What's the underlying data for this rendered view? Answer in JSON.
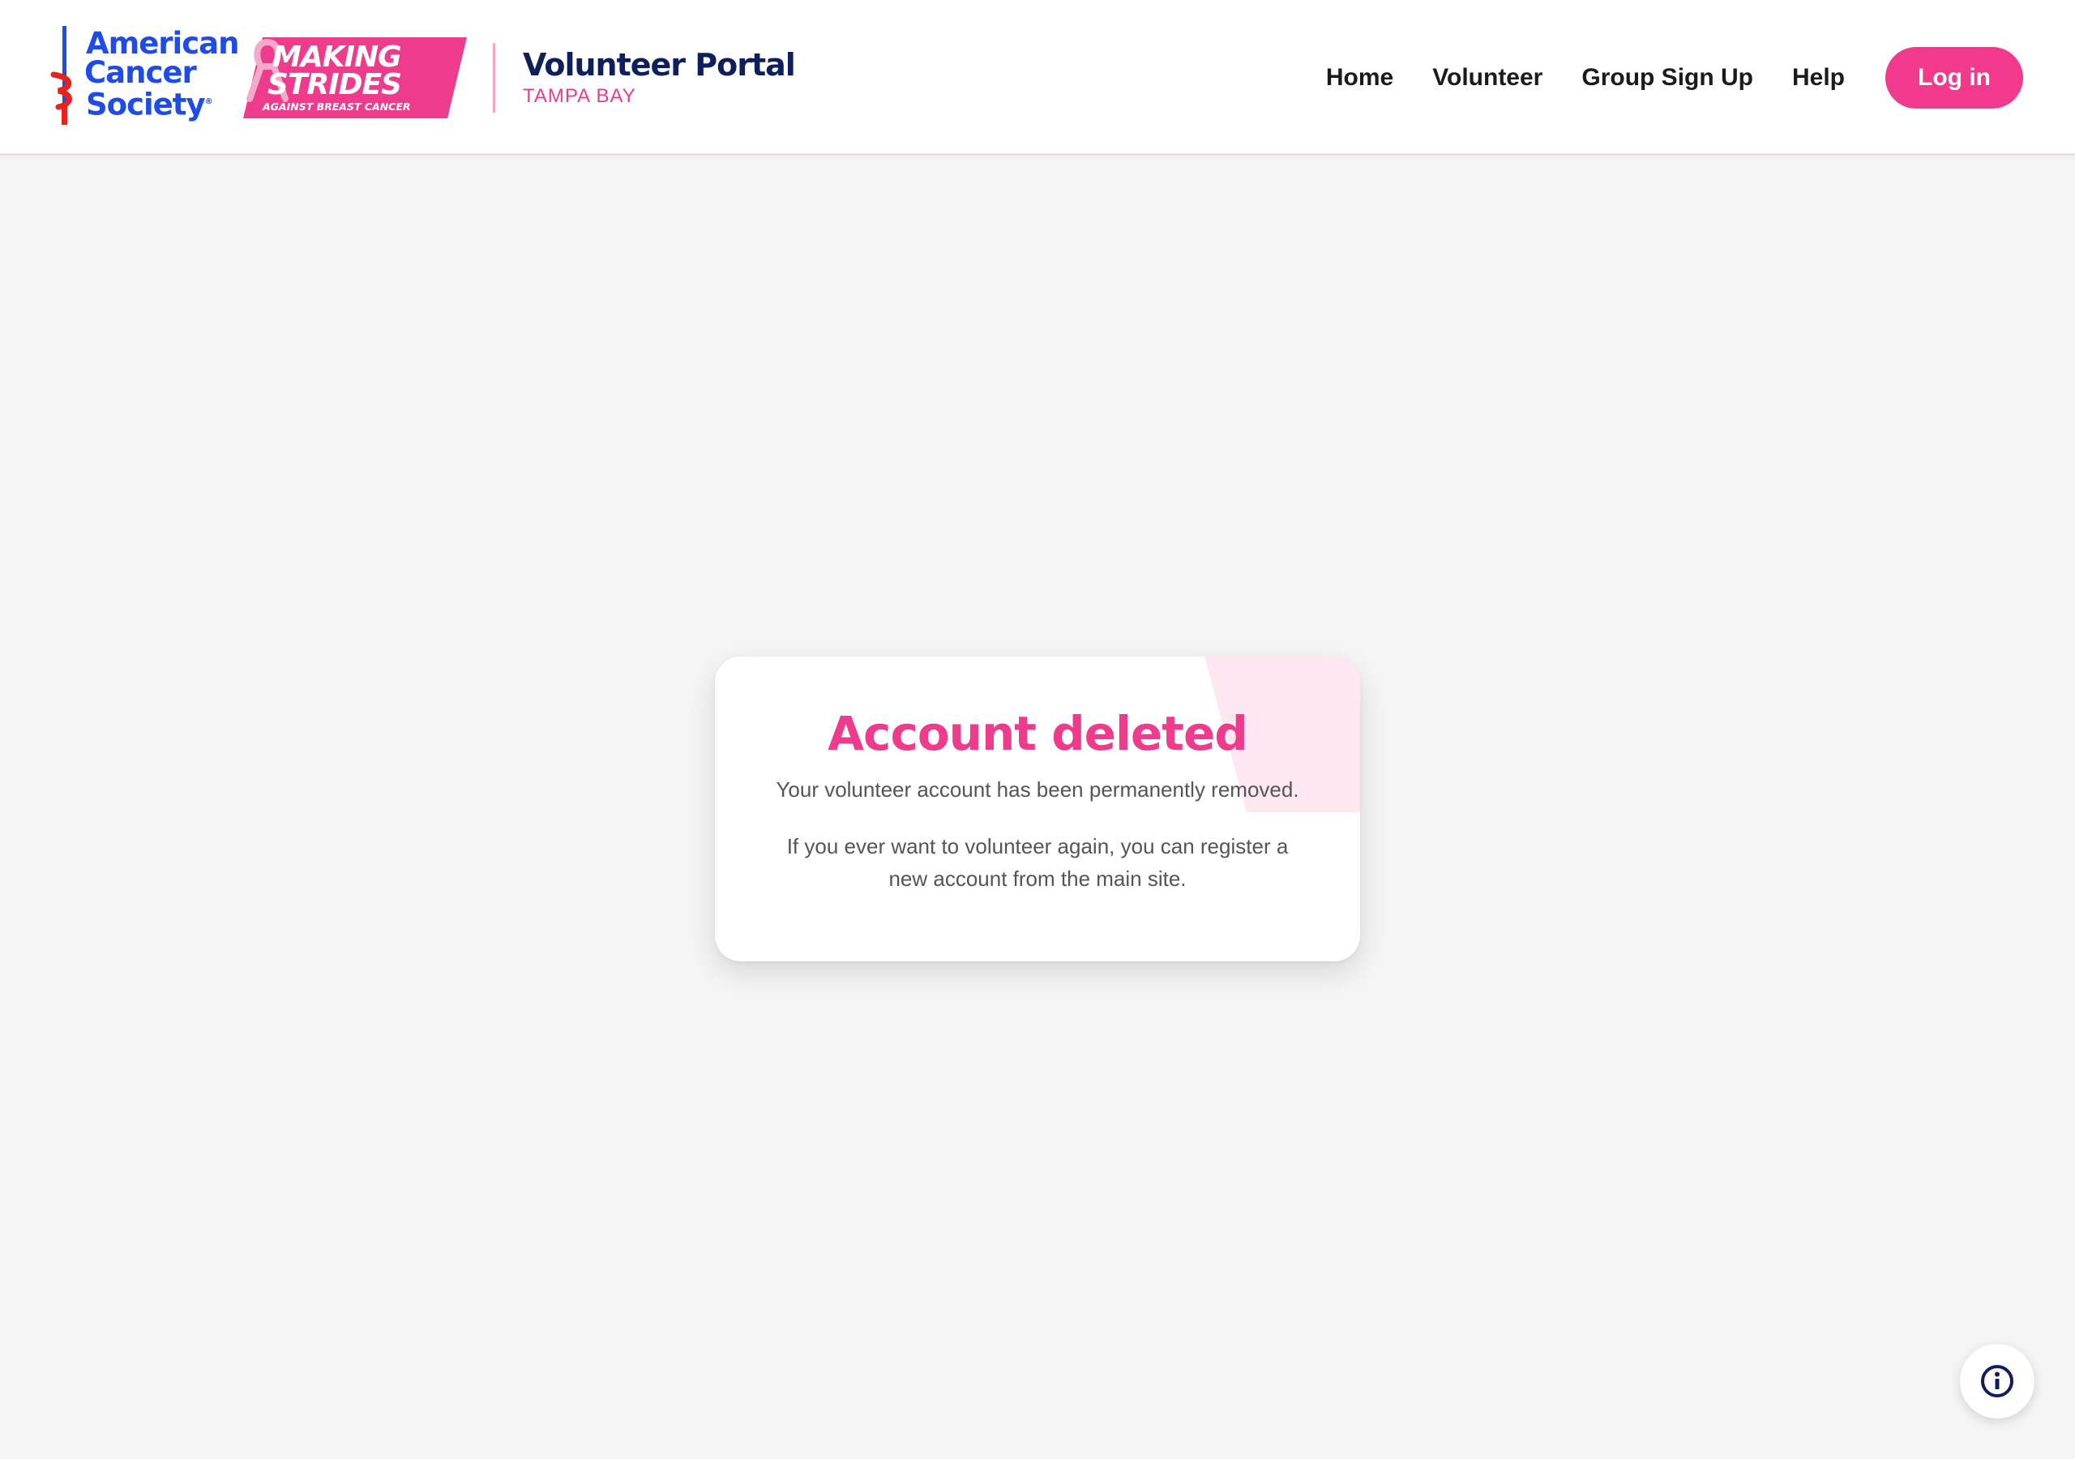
{
  "header": {
    "acs_logo_lines": [
      "American",
      "Cancer",
      "Society"
    ],
    "making_strides_lines": [
      "MAKING",
      "STRIDES",
      "AGAINST BREAST CANCER"
    ],
    "portal_title": "Volunteer Portal",
    "portal_subtitle": "TAMPA BAY"
  },
  "nav": {
    "items": [
      "Home",
      "Volunteer",
      "Group Sign Up",
      "Help"
    ],
    "login_label": "Log in"
  },
  "card": {
    "title": "Account deleted",
    "message": "Your volunteer account has been permanently removed.",
    "note": "If you ever want to volunteer again, you can register a new account from the main site."
  },
  "icons": {
    "info": "info-icon",
    "sword": "sword-of-hope-icon",
    "ribbon": "pink-ribbon-icon"
  },
  "colors": {
    "brand_pink": "#f2398b",
    "brand_navy": "#0f1f5c",
    "acs_blue": "#1f4be8",
    "background": "#f5f5f5",
    "accent_pink_light": "#fde8f1"
  }
}
